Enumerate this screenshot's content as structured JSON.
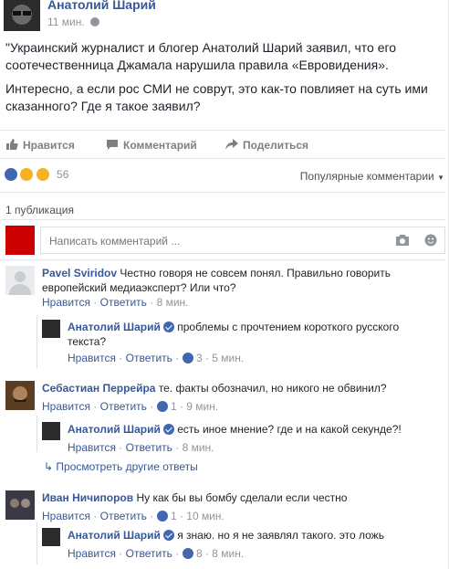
{
  "post": {
    "author": "Анатолий Шарий",
    "time": "11 мин.",
    "paragraph1": "\"Украинский журналист и блогер Анатолий Шарий заявил, что его соотечественница Джамала нарушила правила «Евровидения».",
    "paragraph2": "Интересно, а если рос СМИ не соврут, это как-то повлияет на суть ими сказанного? Где я такое заявил?"
  },
  "actions": {
    "like": "Нравится",
    "comment": "Комментарий",
    "share": "Поделиться"
  },
  "reactions": {
    "count": "56",
    "sort": "Популярные комментарии"
  },
  "publications": "1 публикация",
  "comment_input": {
    "placeholder": "Написать комментарий ..."
  },
  "comments": [
    {
      "name": "Pavel Sviridov",
      "text": "Честно говоря не совсем понял. Правильно говорить европейский медиаэксперт? Или что?",
      "like": "Нравится",
      "reply": "Ответить",
      "time": "8 мин.",
      "replies": [
        {
          "name": "Анатолий Шарий",
          "text": "проблемы с прочтением короткого русского текста?",
          "like": "Нравится",
          "reply": "Ответить",
          "likes": "3",
          "time": "5 мин."
        }
      ]
    },
    {
      "name": "Себастиан Перрейра",
      "text": "те. факты обозначил, но никого не обвинил?",
      "like": "Нравится",
      "reply": "Ответить",
      "likes": "1",
      "time": "9 мин.",
      "replies": [
        {
          "name": "Анатолий Шарий",
          "text": "есть иное мнение? где и на какой секунде?!",
          "like": "Нравится",
          "reply": "Ответить",
          "time": "8 мин."
        }
      ],
      "more_replies": "Просмотреть другие ответы"
    },
    {
      "name": "Иван Ничипоров",
      "text": "Ну как бы вы бомбу сделали если честно",
      "like": "Нравится",
      "reply": "Ответить",
      "likes": "1",
      "time": "10 мин.",
      "replies": [
        {
          "name": "Анатолий Шарий",
          "text": "я знаю. но я не заявлял такого. это ложь",
          "like": "Нравится",
          "reply": "Ответить",
          "likes": "8",
          "time": "8 мин."
        }
      ]
    }
  ],
  "colors": {
    "link": "#365899",
    "meta": "#90949c",
    "like_blue": "#4267b2"
  }
}
